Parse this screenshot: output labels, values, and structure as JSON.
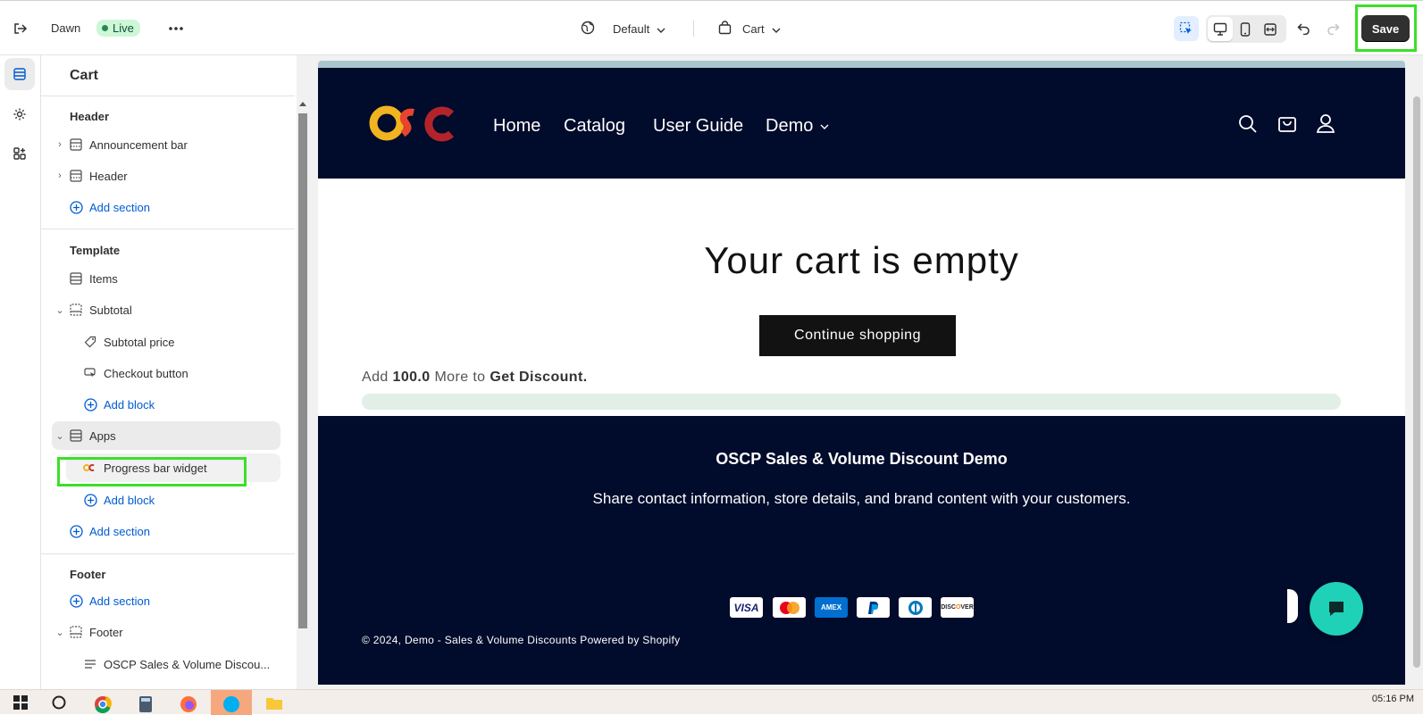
{
  "topbar": {
    "theme_name": "Dawn",
    "status_badge": "Live",
    "template_select": "Default",
    "page_select": "Cart",
    "save_label": "Save"
  },
  "sidebar": {
    "title": "Cart",
    "groups": {
      "header": "Header",
      "template": "Template",
      "footer": "Footer"
    },
    "items": {
      "announcement_bar": "Announcement bar",
      "header": "Header",
      "add_section_header": "Add section",
      "items": "Items",
      "subtotal": "Subtotal",
      "subtotal_price": "Subtotal price",
      "checkout_button": "Checkout button",
      "add_block_subtotal": "Add block",
      "apps": "Apps",
      "progress_bar_widget": "Progress bar widget",
      "add_block_apps": "Add block",
      "add_section_template": "Add section",
      "add_section_footer": "Add section",
      "footer": "Footer",
      "footer_text": "OSCP Sales & Volume Discou..."
    }
  },
  "store": {
    "nav": [
      "Home",
      "Catalog",
      "User Guide",
      "Demo"
    ],
    "cart_empty": "Your cart is empty",
    "continue_shopping": "Continue shopping",
    "progress": {
      "prefix": "Add",
      "amount": "100.0",
      "middle": "More to",
      "target": "Get Discount.",
      "fraction": 0
    },
    "footer": {
      "title": "OSCP Sales & Volume Discount Demo",
      "description": "Share contact information, store details, and brand content with your customers.",
      "copyright": "© 2024, Demo - Sales & Volume Discounts Powered by Shopify"
    },
    "payments": [
      "VISA",
      "mastercard",
      "AMEX",
      "PayPal",
      "diners",
      "DISCOVER"
    ]
  },
  "taskbar": {
    "clock": "05:16 PM"
  },
  "colors": {
    "store_bg": "#010b2b",
    "highlight": "#3ae028",
    "link": "#005bd3",
    "chat": "#1fd1b6"
  }
}
